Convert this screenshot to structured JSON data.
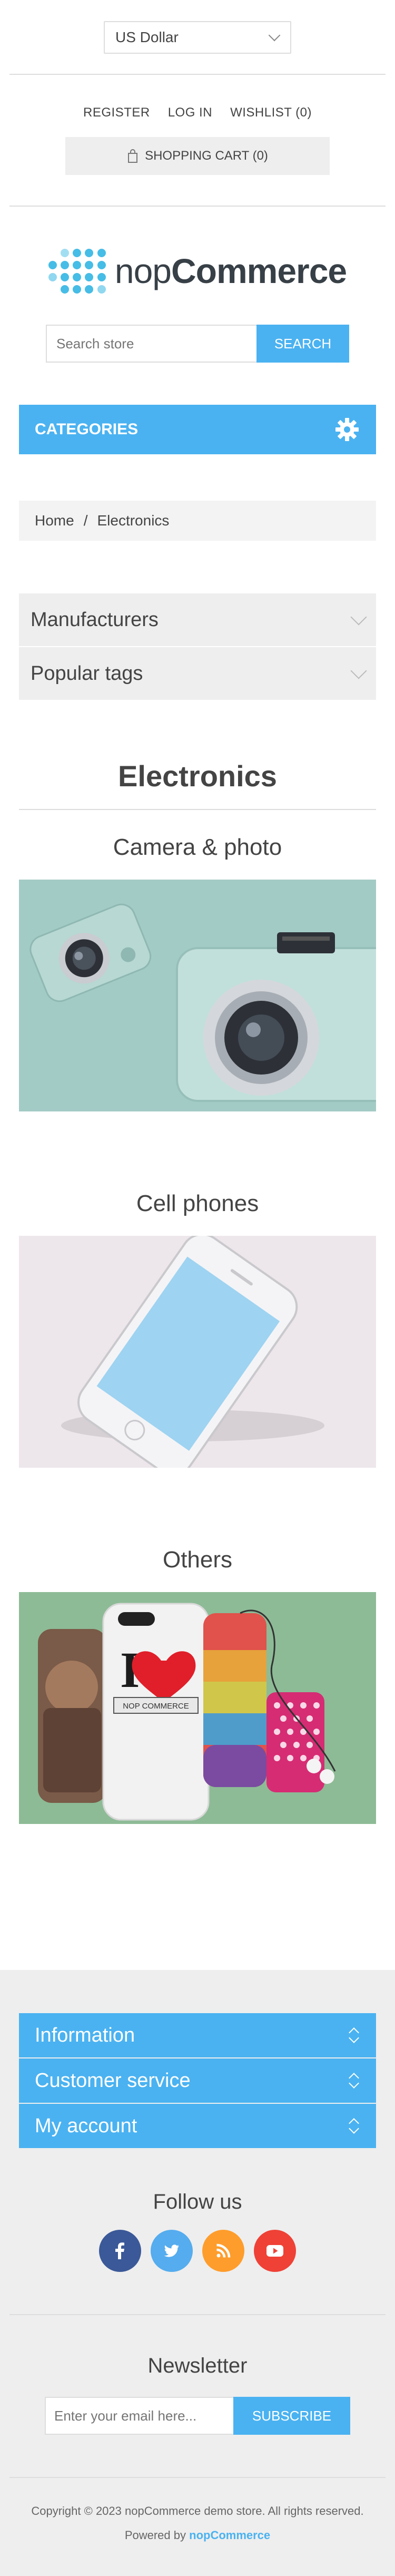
{
  "header": {
    "currency": "US Dollar",
    "links": [
      "REGISTER",
      "LOG IN",
      "WISHLIST (0)"
    ],
    "cart": "SHOPPING CART (0)"
  },
  "logo": {
    "prefix": "nop",
    "name": "Commerce"
  },
  "search": {
    "placeholder": "Search store",
    "button": "SEARCH"
  },
  "categories": {
    "label": "CATEGORIES",
    "icon": "gear-icon"
  },
  "breadcrumb": {
    "home": "Home",
    "separator": "/",
    "current": "Electronics"
  },
  "side_blocks": [
    {
      "label": "Manufacturers"
    },
    {
      "label": "Popular tags"
    }
  ],
  "page_title": "Electronics",
  "subcategories": [
    {
      "name": "Camera & photo"
    },
    {
      "name": "Cell phones"
    },
    {
      "name": "Others"
    }
  ],
  "others_image_text": "NOP COMMERCE",
  "footer": {
    "blocks": [
      "Information",
      "Customer service",
      "My account"
    ],
    "follow_title": "Follow us",
    "social": [
      "facebook-icon",
      "twitter-icon",
      "rss-icon",
      "youtube-icon"
    ],
    "newsletter_title": "Newsletter",
    "newsletter_placeholder": "Enter your email here...",
    "subscribe": "SUBSCRIBE",
    "copyright": "Copyright © 2023 nopCommerce demo store. All rights reserved.",
    "powered_prefix": "Powered by",
    "powered_name": "nopCommerce"
  },
  "colors": {
    "accent": "#4ab2f1",
    "logo_dots": "#46bde6",
    "footer_bg": "#eeeeee"
  }
}
